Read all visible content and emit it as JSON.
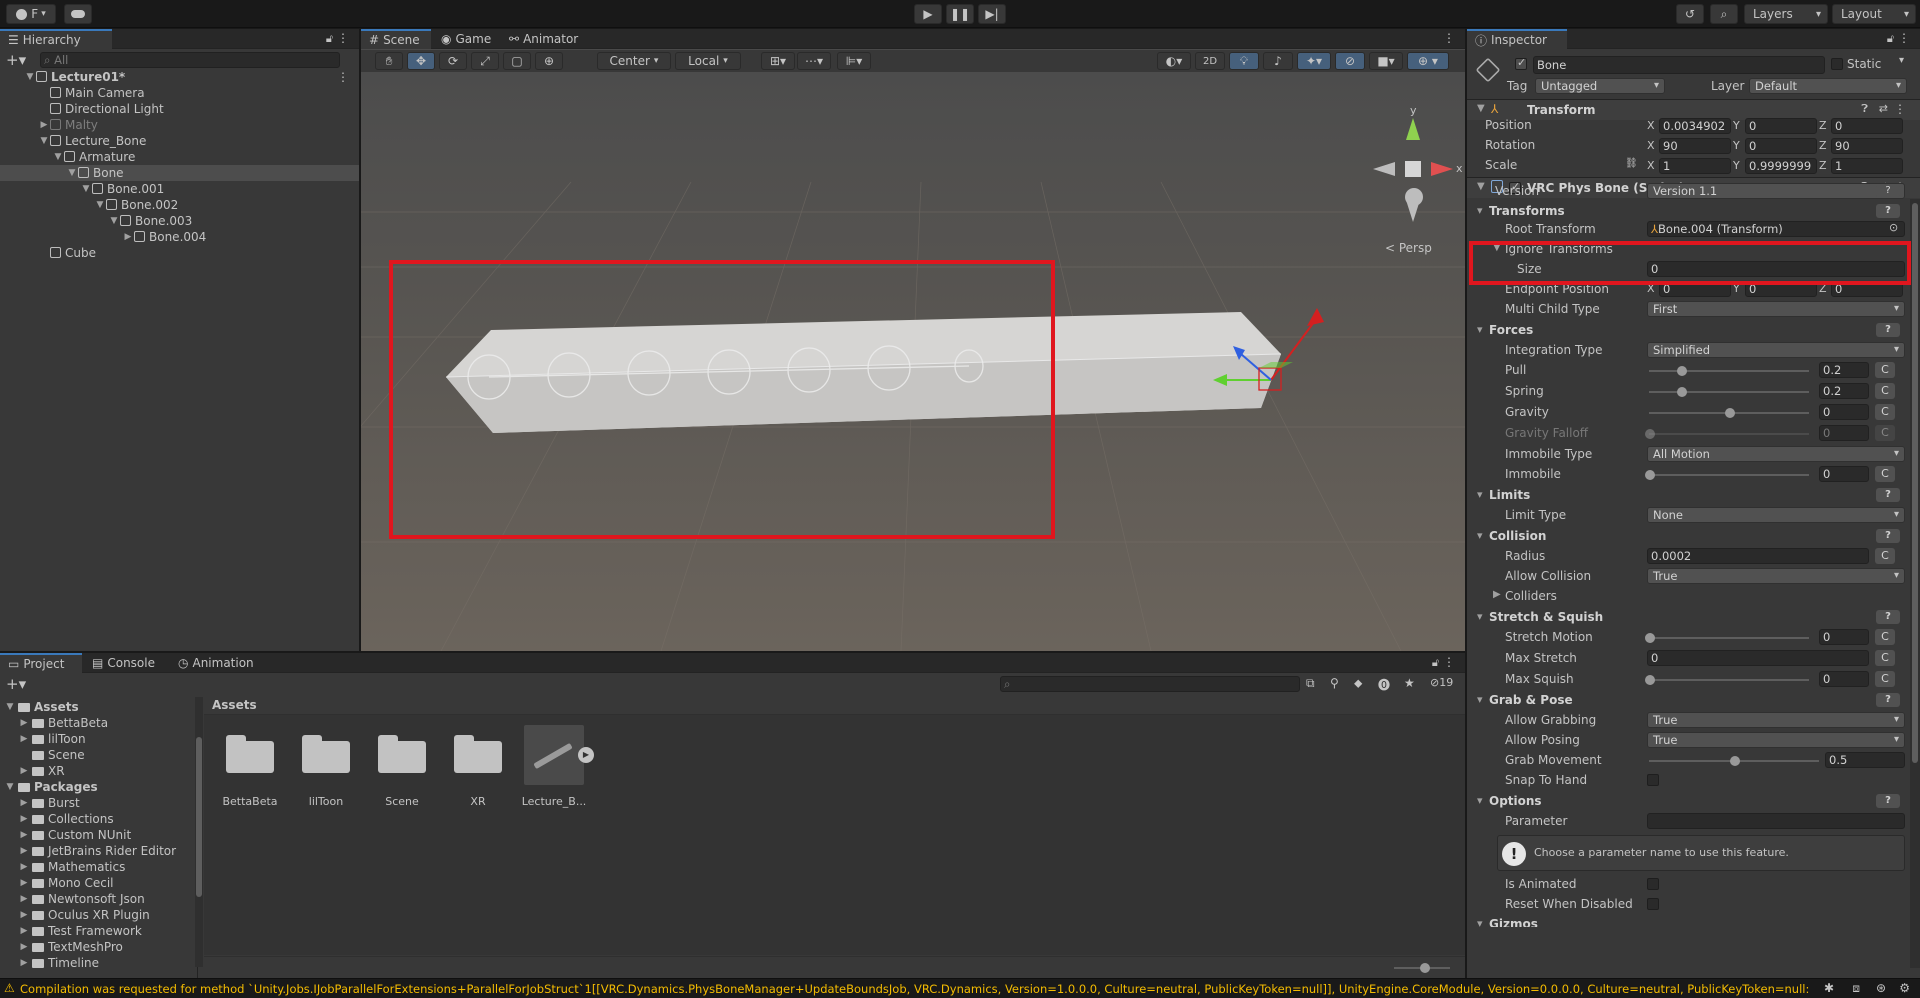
{
  "toolbar": {
    "account_label": "F",
    "play_icon": "play-icon",
    "layers_label": "Layers",
    "layout_label": "Layout"
  },
  "hierarchy": {
    "tab": "Hierarchy",
    "search_placeholder": "All",
    "items": [
      {
        "label": "Lecture01*",
        "depth": 0,
        "arrow": "▼",
        "bold": true
      },
      {
        "label": "Main Camera",
        "depth": 1,
        "arrow": ""
      },
      {
        "label": "Directional Light",
        "depth": 1,
        "arrow": ""
      },
      {
        "label": "Malty",
        "depth": 1,
        "arrow": "▶",
        "dim": true
      },
      {
        "label": "Lecture_Bone",
        "depth": 1,
        "arrow": "▼"
      },
      {
        "label": "Armature",
        "depth": 2,
        "arrow": "▼"
      },
      {
        "label": "Bone",
        "depth": 3,
        "arrow": "▼",
        "selected": true
      },
      {
        "label": "Bone.001",
        "depth": 4,
        "arrow": "▼"
      },
      {
        "label": "Bone.002",
        "depth": 5,
        "arrow": "▼"
      },
      {
        "label": "Bone.003",
        "depth": 6,
        "arrow": "▼"
      },
      {
        "label": "Bone.004",
        "depth": 7,
        "arrow": "▶"
      },
      {
        "label": "Cube",
        "depth": 1,
        "arrow": ""
      }
    ]
  },
  "scene": {
    "tabs": [
      "Scene",
      "Game",
      "Animator"
    ],
    "pivot_label": "Center",
    "space_label": "Local",
    "mode_2d": "2D",
    "persp_label": "< Persp",
    "gizmo_y": "y",
    "gizmo_x": "x"
  },
  "inspector": {
    "tab": "Inspector",
    "object_name": "Bone",
    "static_label": "Static",
    "tag_label": "Tag",
    "tag_value": "Untagged",
    "layer_label": "Layer",
    "layer_value": "Default",
    "transform": {
      "title": "Transform",
      "position_label": "Position",
      "rotation_label": "Rotation",
      "scale_label": "Scale",
      "position": {
        "x": "0.0034902",
        "y": "0",
        "z": "0"
      },
      "rotation": {
        "x": "90",
        "y": "0",
        "z": "90"
      },
      "scale": {
        "x": "1",
        "y": "0.9999999",
        "z": "1"
      }
    },
    "physbone": {
      "title": "VRC Phys Bone (Script)",
      "version_label": "Version",
      "version_value": "Version 1.1",
      "transforms_section": "Transforms",
      "root_transform_label": "Root Transform",
      "root_transform_value": "Bone.004 (Transform)",
      "ignore_transforms_label": "Ignore Transforms",
      "size_label": "Size",
      "size_value": "0",
      "endpoint_label": "Endpoint Position",
      "endpoint": {
        "x": "0",
        "y": "0",
        "z": "0"
      },
      "multi_child_label": "Multi Child Type",
      "multi_child_value": "First",
      "forces_section": "Forces",
      "integration_label": "Integration Type",
      "integration_value": "Simplified",
      "pull_label": "Pull",
      "pull_value": "0.2",
      "spring_label": "Spring",
      "spring_value": "0.2",
      "gravity_label": "Gravity",
      "gravity_value": "0",
      "gravity_falloff_label": "Gravity Falloff",
      "gravity_falloff_value": "0",
      "immobile_type_label": "Immobile Type",
      "immobile_type_value": "All Motion",
      "immobile_label": "Immobile",
      "immobile_value": "0",
      "limits_section": "Limits",
      "limit_type_label": "Limit Type",
      "limit_type_value": "None",
      "collision_section": "Collision",
      "radius_label": "Radius",
      "radius_value": "0.0002",
      "allow_collision_label": "Allow Collision",
      "allow_collision_value": "True",
      "colliders_label": "Colliders",
      "stretch_section": "Stretch & Squish",
      "stretch_motion_label": "Stretch Motion",
      "stretch_motion_value": "0",
      "max_stretch_label": "Max Stretch",
      "max_stretch_value": "0",
      "max_squish_label": "Max Squish",
      "max_squish_value": "0",
      "grab_section": "Grab & Pose",
      "allow_grabbing_label": "Allow Grabbing",
      "allow_grabbing_value": "True",
      "allow_posing_label": "Allow Posing",
      "allow_posing_value": "True",
      "grab_movement_label": "Grab Movement",
      "grab_movement_value": "0.5",
      "snap_label": "Snap To Hand",
      "options_section": "Options",
      "parameter_label": "Parameter",
      "parameter_help": "Choose a parameter name to use this feature.",
      "is_animated_label": "Is Animated",
      "reset_label": "Reset When Disabled",
      "gizmos_label": "Gizmos",
      "c_label": "C",
      "q_label": "?"
    },
    "sliders": {
      "pull": 0.2,
      "spring": 0.2,
      "gravity": 0.5,
      "gravity_falloff": 0,
      "immobile": 0,
      "stretch_motion": 0,
      "max_squish": 0,
      "grab_movement": 0.5
    }
  },
  "project": {
    "tabs": [
      "Project",
      "Console",
      "Animation"
    ],
    "badge_count": "19",
    "tree": [
      {
        "label": "Assets",
        "depth": 0,
        "bold": true,
        "arrow": "▼"
      },
      {
        "label": "BettaBeta",
        "depth": 1,
        "arrow": "▶"
      },
      {
        "label": "lilToon",
        "depth": 1,
        "arrow": "▶"
      },
      {
        "label": "Scene",
        "depth": 1,
        "arrow": ""
      },
      {
        "label": "XR",
        "depth": 1,
        "arrow": "▶"
      },
      {
        "label": "Packages",
        "depth": 0,
        "bold": true,
        "arrow": "▼"
      },
      {
        "label": "Burst",
        "depth": 1,
        "arrow": "▶"
      },
      {
        "label": "Collections",
        "depth": 1,
        "arrow": "▶"
      },
      {
        "label": "Custom NUnit",
        "depth": 1,
        "arrow": "▶"
      },
      {
        "label": "JetBrains Rider Editor",
        "depth": 1,
        "arrow": "▶"
      },
      {
        "label": "Mathematics",
        "depth": 1,
        "arrow": "▶"
      },
      {
        "label": "Mono Cecil",
        "depth": 1,
        "arrow": "▶"
      },
      {
        "label": "Newtonsoft Json",
        "depth": 1,
        "arrow": "▶"
      },
      {
        "label": "Oculus XR Plugin",
        "depth": 1,
        "arrow": "▶"
      },
      {
        "label": "Test Framework",
        "depth": 1,
        "arrow": "▶"
      },
      {
        "label": "TextMeshPro",
        "depth": 1,
        "arrow": "▶"
      },
      {
        "label": "Timeline",
        "depth": 1,
        "arrow": "▶"
      }
    ],
    "breadcrumb": "Assets",
    "assets": [
      "BettaBeta",
      "lilToon",
      "Scene",
      "XR",
      "Lecture_B..."
    ]
  },
  "status": {
    "message": "Compilation was requested for method `Unity.Jobs.IJobParallelForExtensions+ParallelForJobStruct`1[[VRC.Dynamics.PhysBoneManager+UpdateBoundsJob, VRC.Dynamics, Version=1.0.0.0, Culture=neutral, PublicKeyToken=null]], UnityEngine.CoreModule, Version=0.0.0.0, Culture=neutral, PublicKeyToken=null::E:"
  },
  "colors": {
    "highlight_red": "#e0161e",
    "accent_blue": "#3a79bb",
    "warning_yellow": "#f4bc02"
  }
}
